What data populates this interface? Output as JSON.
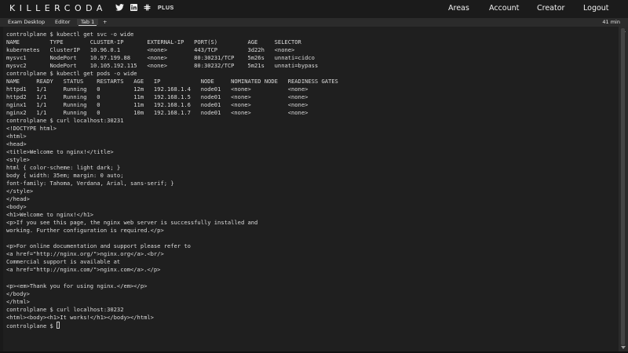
{
  "header": {
    "logo": "KILLERCODA",
    "plus_label": "PLUS",
    "nav": {
      "areas": "Areas",
      "account": "Account",
      "creator": "Creator",
      "logout": "Logout"
    }
  },
  "tabs": {
    "items": [
      "Exam Desktop",
      "Editor",
      "Tab 1"
    ],
    "add_label": "+",
    "active": "Tab 1",
    "timer": "41 min"
  },
  "icons": {
    "social": [
      "twitter-icon",
      "linkedin-icon",
      "slack-icon"
    ]
  },
  "terminal": {
    "lines": [
      "controlplane $ kubectl get svc -o wide",
      "NAME         TYPE        CLUSTER-IP       EXTERNAL-IP   PORT(S)         AGE     SELECTOR",
      "kubernetes   ClusterIP   10.96.0.1        <none>        443/TCP         3d22h   <none>",
      "mysvc1       NodePort    10.97.199.88     <none>        80:30231/TCP    5m26s   unnati=cidco",
      "mysvc2       NodePort    10.105.192.115   <none>        80:30232/TCP    5m21s   unnati=bypass",
      "controlplane $ kubectl get pods -o wide",
      "NAME     READY   STATUS    RESTARTS   AGE   IP            NODE     NOMINATED NODE   READINESS GATES",
      "httpd1   1/1     Running   0          12m   192.168.1.4   node01   <none>           <none>",
      "httpd2   1/1     Running   0          11m   192.168.1.5   node01   <none>           <none>",
      "nginx1   1/1     Running   0          11m   192.168.1.6   node01   <none>           <none>",
      "nginx2   1/1     Running   0          10m   192.168.1.7   node01   <none>           <none>",
      "controlplane $ curl localhost:30231",
      "<!DOCTYPE html>",
      "<html>",
      "<head>",
      "<title>Welcome to nginx!</title>",
      "<style>",
      "html { color-scheme: light dark; }",
      "body { width: 35em; margin: 0 auto;",
      "font-family: Tahoma, Verdana, Arial, sans-serif; }",
      "</style>",
      "</head>",
      "<body>",
      "<h1>Welcome to nginx!</h1>",
      "<p>If you see this page, the nginx web server is successfully installed and",
      "working. Further configuration is required.</p>",
      "",
      "<p>For online documentation and support please refer to",
      "<a href=\"http://nginx.org/\">nginx.org</a>.<br/>",
      "Commercial support is available at",
      "<a href=\"http://nginx.com/\">nginx.com</a>.</p>",
      "",
      "<p><em>Thank you for using nginx.</em></p>",
      "</body>",
      "</html>",
      "controlplane $ curl localhost:30232",
      "<html><body><h1>It works!</h1></body></html>"
    ],
    "prompt": "controlplane $ "
  },
  "colors": {
    "background": "#1a1a1a",
    "terminal_bg": "#1f1f1f",
    "tabbar_bg": "#2b2b2b",
    "text": "#dcdcdc"
  }
}
